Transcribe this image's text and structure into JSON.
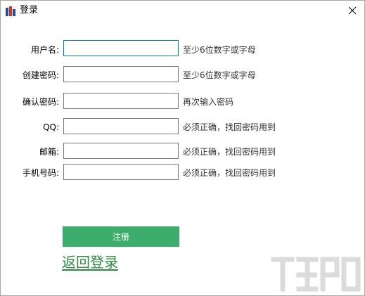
{
  "window": {
    "title": "登录"
  },
  "form": {
    "fields": [
      {
        "label": "用户名:",
        "value": "",
        "hint": "至少6位数字或字母"
      },
      {
        "label": "创建密码:",
        "value": "",
        "hint": "至少6位数字或字母"
      },
      {
        "label": "确认密码:",
        "value": "",
        "hint": "再次输入密码"
      },
      {
        "label": "QQ:",
        "value": "",
        "hint": "必须正确，找回密码用到"
      },
      {
        "label": "邮箱:",
        "value": "",
        "hint": "必须正确，找回密码用到"
      },
      {
        "label": "手机号码:",
        "value": "",
        "hint": "必须正确，找回密码用到"
      }
    ]
  },
  "actions": {
    "register_label": "注册",
    "back_to_login_label": "返回登录"
  },
  "colors": {
    "accent_green": "#3dad6b",
    "link_green": "#2e8b3e",
    "focus_blue": "#0078d7"
  }
}
